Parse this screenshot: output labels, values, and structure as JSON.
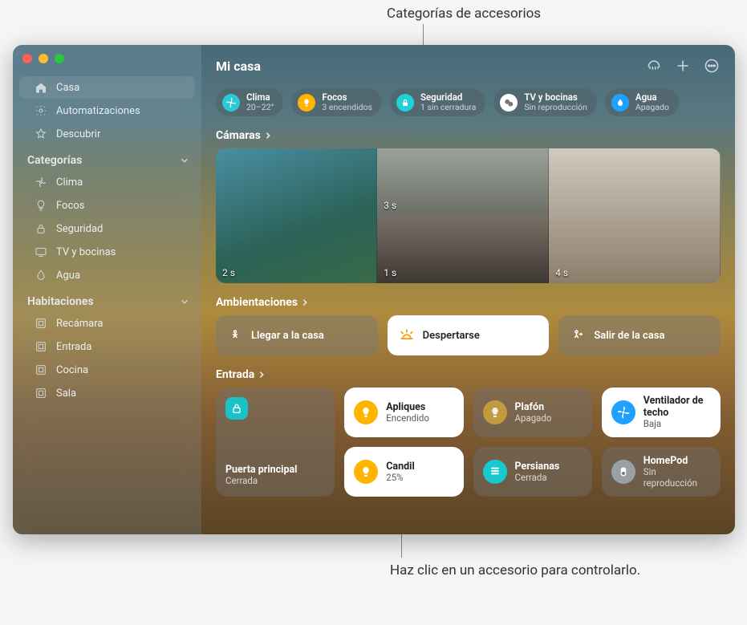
{
  "callouts": {
    "top": "Categorías de accesorios",
    "bottom": "Haz clic en un accesorio para controlarlo."
  },
  "window": {
    "title": "Mi casa"
  },
  "sidebar": {
    "topItems": [
      {
        "icon": "home",
        "label": "Casa"
      },
      {
        "icon": "automation",
        "label": "Automatizaciones"
      },
      {
        "icon": "star",
        "label": "Descubrir"
      }
    ],
    "categoriesHeader": "Categorías",
    "categories": [
      {
        "icon": "fan",
        "label": "Clima"
      },
      {
        "icon": "bulb",
        "label": "Focos"
      },
      {
        "icon": "lock",
        "label": "Seguridad"
      },
      {
        "icon": "tv",
        "label": "TV y bocinas"
      },
      {
        "icon": "drop",
        "label": "Agua"
      }
    ],
    "roomsHeader": "Habitaciones",
    "rooms": [
      {
        "label": "Recámara"
      },
      {
        "label": "Entrada"
      },
      {
        "label": "Cocina"
      },
      {
        "label": "Sala"
      }
    ]
  },
  "categoryChips": [
    {
      "color": "#2ac9d6",
      "label": "Clima",
      "status": "20–22°"
    },
    {
      "color": "#ffb500",
      "label": "Focos",
      "status": "3 encendidos"
    },
    {
      "color": "#1fd2d8",
      "label": "Seguridad",
      "status": "1 sin cerradura"
    },
    {
      "color": "#ffffff",
      "label": "TV y bocinas",
      "status": "Sin reproducción",
      "fg": "#666"
    },
    {
      "color": "#1fa2ff",
      "label": "Agua",
      "status": "Apagado"
    }
  ],
  "sections": {
    "cameras": "Cámaras",
    "scenes": "Ambientaciones",
    "room": "Entrada"
  },
  "cameras": [
    {
      "ts": "2 s"
    },
    {
      "ts": "3 s"
    },
    {
      "ts": "1 s"
    },
    {
      "ts": "4 s"
    }
  ],
  "scenes": [
    {
      "label": "Llegar a la casa",
      "active": false
    },
    {
      "label": "Despertarse",
      "active": true
    },
    {
      "label": "Salir de la casa",
      "active": false
    }
  ],
  "roomTiles": {
    "door": {
      "label": "Puerta principal",
      "status": "Cerrada"
    },
    "tiles": [
      {
        "label": "Apliques",
        "status": "Encendido",
        "light": true,
        "iconClass": "c-yellow"
      },
      {
        "label": "Plafón",
        "status": "Apagado",
        "light": false,
        "iconClass": "c-yellow-dim"
      },
      {
        "label": "Ventilador de techo",
        "status": "Baja",
        "light": true,
        "iconClass": "c-blue"
      },
      {
        "label": "Candil",
        "status": "25%",
        "light": true,
        "iconClass": "c-yellow"
      },
      {
        "label": "Persianas",
        "status": "Cerrada",
        "light": false,
        "iconClass": "c-teal"
      },
      {
        "label": "HomePod",
        "status": "Sin reproducción",
        "light": false,
        "iconClass": "c-grey"
      }
    ]
  }
}
